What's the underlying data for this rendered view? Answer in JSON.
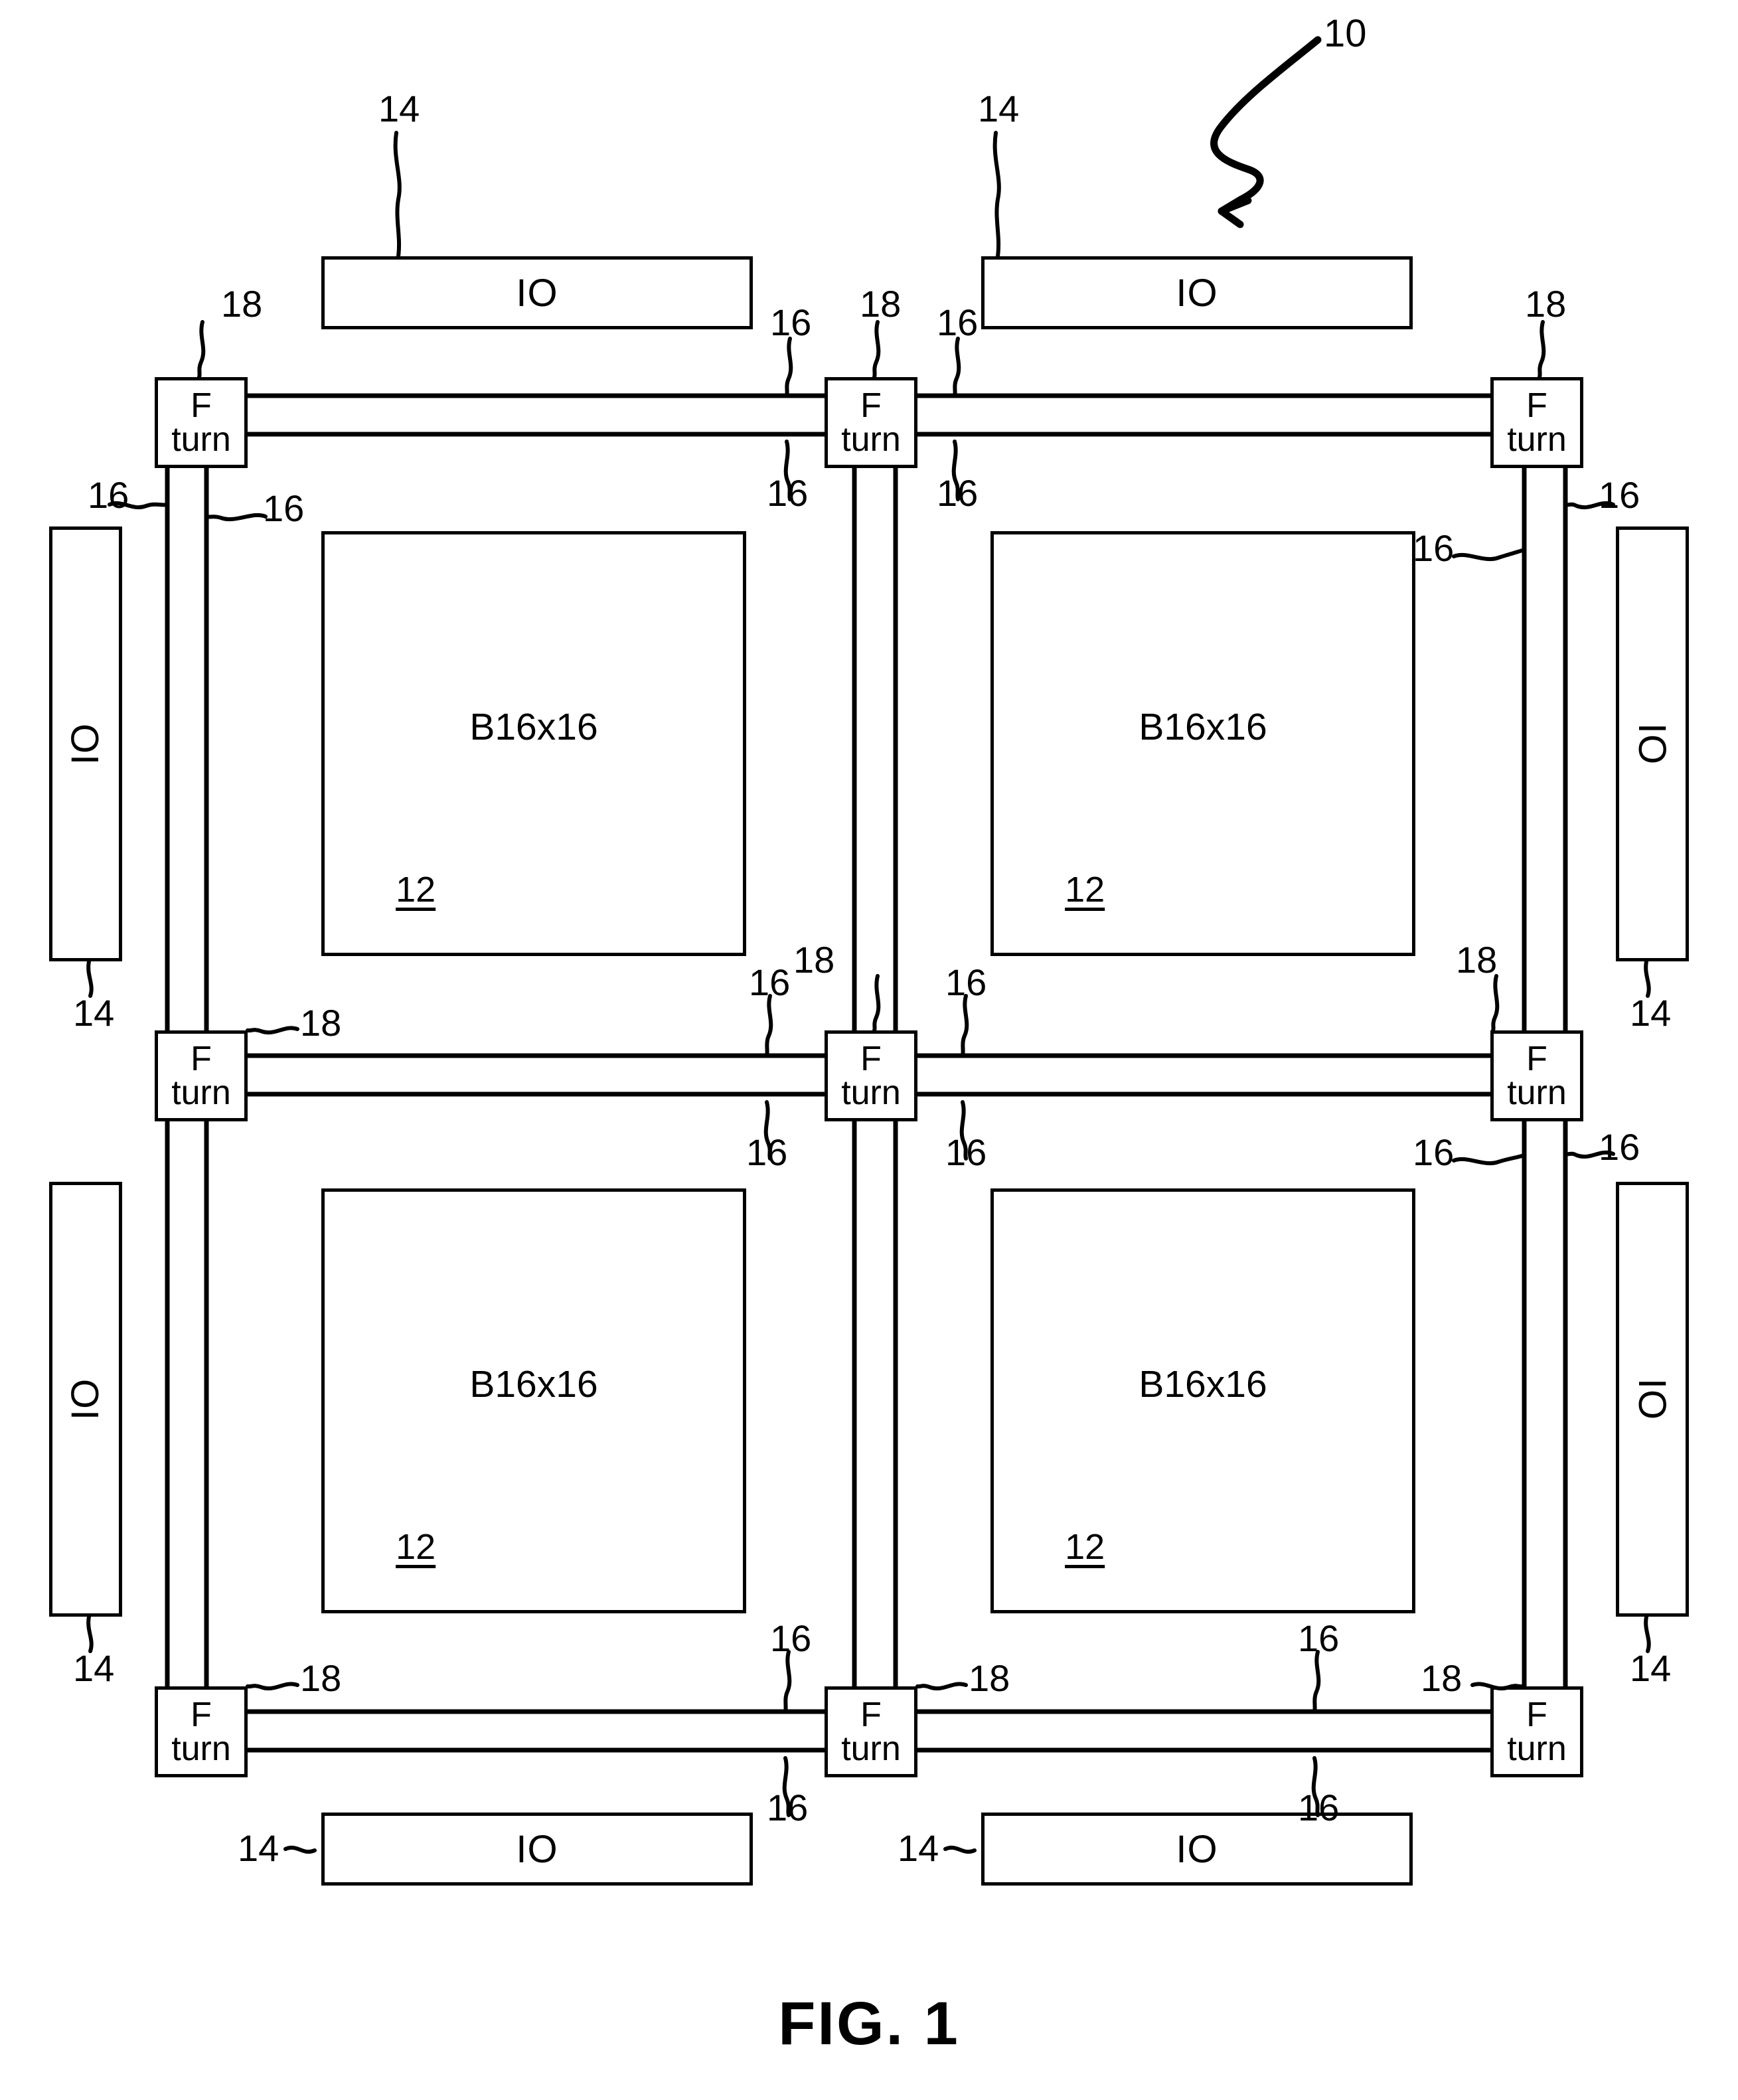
{
  "figure": {
    "caption": "FIG. 1",
    "assembly_ref": "10"
  },
  "blocks": {
    "logic_label": "B16x16",
    "logic_ref": "12",
    "io_label": "IO",
    "io_ref": "14",
    "switch_line1": "F",
    "switch_line2": "turn",
    "switch_ref": "18",
    "bus_ref": "16"
  },
  "logic_blocks": [
    {
      "id": "b-tl",
      "label": "B16x16",
      "ref": "12"
    },
    {
      "id": "b-tr",
      "label": "B16x16",
      "ref": "12"
    },
    {
      "id": "b-bl",
      "label": "B16x16",
      "ref": "12"
    },
    {
      "id": "b-br",
      "label": "B16x16",
      "ref": "12"
    }
  ],
  "io_blocks": [
    {
      "id": "io-top-left",
      "label": "IO",
      "ref": "14",
      "orientation": "horizontal"
    },
    {
      "id": "io-top-right",
      "label": "IO",
      "ref": "14",
      "orientation": "horizontal"
    },
    {
      "id": "io-left-upper",
      "label": "IO",
      "ref": "14",
      "orientation": "vertical"
    },
    {
      "id": "io-left-lower",
      "label": "IO",
      "ref": "14",
      "orientation": "vertical"
    },
    {
      "id": "io-right-upper",
      "label": "IO",
      "ref": "14",
      "orientation": "vertical"
    },
    {
      "id": "io-right-lower",
      "label": "IO",
      "ref": "14",
      "orientation": "vertical"
    },
    {
      "id": "io-bottom-left",
      "label": "IO",
      "ref": "14",
      "orientation": "horizontal"
    },
    {
      "id": "io-bottom-right",
      "label": "IO",
      "ref": "14",
      "orientation": "horizontal"
    }
  ],
  "switch_blocks": [
    {
      "id": "f-r0c0",
      "line1": "F",
      "line2": "turn",
      "ref": "18"
    },
    {
      "id": "f-r0c1",
      "line1": "F",
      "line2": "turn",
      "ref": "18"
    },
    {
      "id": "f-r0c2",
      "line1": "F",
      "line2": "turn",
      "ref": "18"
    },
    {
      "id": "f-r1c0",
      "line1": "F",
      "line2": "turn",
      "ref": "18"
    },
    {
      "id": "f-r1c1",
      "line1": "F",
      "line2": "turn",
      "ref": "18"
    },
    {
      "id": "f-r1c2",
      "line1": "F",
      "line2": "turn",
      "ref": "18"
    },
    {
      "id": "f-r2c0",
      "line1": "F",
      "line2": "turn",
      "ref": "18"
    },
    {
      "id": "f-r2c1",
      "line1": "F",
      "line2": "turn",
      "ref": "18"
    },
    {
      "id": "f-r2c2",
      "line1": "F",
      "line2": "turn",
      "ref": "18"
    }
  ],
  "callouts": {
    "assembly": "10",
    "logic": "12",
    "io": "14",
    "bus": "16",
    "switch": "18"
  }
}
